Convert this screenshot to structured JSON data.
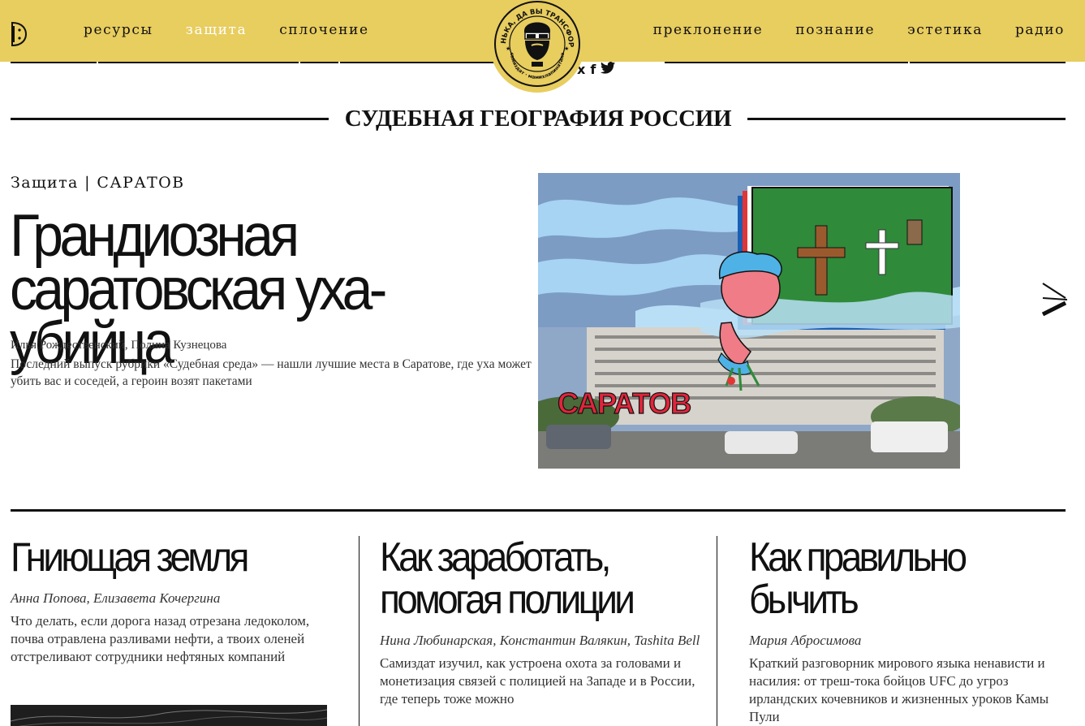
{
  "header": {
    "nav_left": [
      "ресурсы",
      "защита",
      "сплочение"
    ],
    "nav_right": [
      "преклонение",
      "познание",
      "эстетика",
      "радио"
    ],
    "active_item": "защита",
    "logo_text_top": "БАТЕНЬКА, ДА ВЫ ТРАНСФОРМЕР",
    "logo_text_bottom": "самиздат · мамихлапинатана",
    "social": [
      "vk-icon",
      "facebook-icon",
      "twitter-icon"
    ]
  },
  "section": {
    "title": "СУДЕБНАЯ ГЕОГРАФИЯ РОССИИ"
  },
  "hero": {
    "category": "Защита | САРАТОВ",
    "title": "Грандиозная саратовская уха-убийца",
    "authors": "Илья Рождественский, Полина Кузнецова",
    "lead": "Последний выпуск рубрики «Судебная среда» — нашли лучшие места в Саратове, где уха может убить вас и соседей, а героин возят пакетами",
    "image_caption": "САРАТОВ"
  },
  "cards": [
    {
      "title": "Гниющая земля",
      "authors": "Анна Попова, Елизавета Кочергина",
      "lead": "Что делать, если дорога назад отрезана ледоколом, почва отравлена разливами нефти, а твоих оленей отстреливают сотрудники нефтяных компаний"
    },
    {
      "title_line1": "Как заработать,",
      "title_line2": "помогая полиции",
      "authors": "Нина Любинарская, Константин Валякин, Tashita Bell",
      "lead": "Самиздат изучил, как устроена охота за головами и монетизация связей с полицией на Западе и в России, где теперь тоже можно"
    },
    {
      "title_line1": "Как правильно",
      "title_line2": "бычить",
      "authors": "Мария Абросимова",
      "lead": "Краткий разговорник мирового языка ненависти и насилия: от треш-тока бойцов UFC до угроз ирландских кочевников и жизненных уроков Камы Пули"
    }
  ],
  "colors": {
    "header_bg": "#e8cd5f",
    "text": "#111111",
    "active_nav": "#ffffff"
  }
}
